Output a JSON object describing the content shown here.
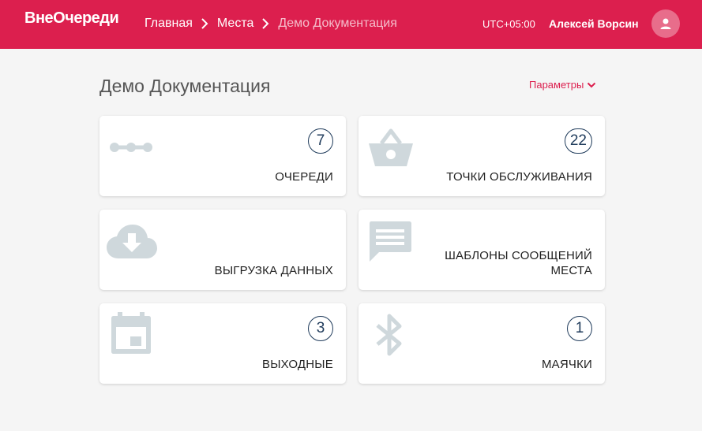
{
  "header": {
    "logo": "ВнеОчереди",
    "breadcrumbs": [
      "Главная",
      "Места",
      "Демо Документация"
    ],
    "timezone": "UTC+05:00",
    "user_name": "Алексей Ворсин"
  },
  "page": {
    "title": "Демо Документация",
    "params_label": "Параметры"
  },
  "cards": [
    {
      "label": "ОЧЕРЕДИ",
      "count": "7",
      "icon": "queue-dots-icon"
    },
    {
      "label": "ТОЧКИ ОБСЛУЖИВАНИЯ",
      "count": "22",
      "icon": "basket-icon"
    },
    {
      "label": "ВЫГРУЗКА ДАННЫХ",
      "icon": "cloud-download-icon"
    },
    {
      "label_line1": "ШАБЛОНЫ СООБЩЕНИЙ",
      "label_line2": "МЕСТА",
      "icon": "message-icon"
    },
    {
      "label": "ВЫХОДНЫЕ",
      "count": "3",
      "icon": "calendar-icon"
    },
    {
      "label": "МАЯЧКИ",
      "count": "1",
      "icon": "bluetooth-icon"
    }
  ],
  "colors": {
    "brand": "#dc1f4e",
    "icon_gray": "#cfd8dc",
    "badge_outline": "#1e3a5a"
  }
}
